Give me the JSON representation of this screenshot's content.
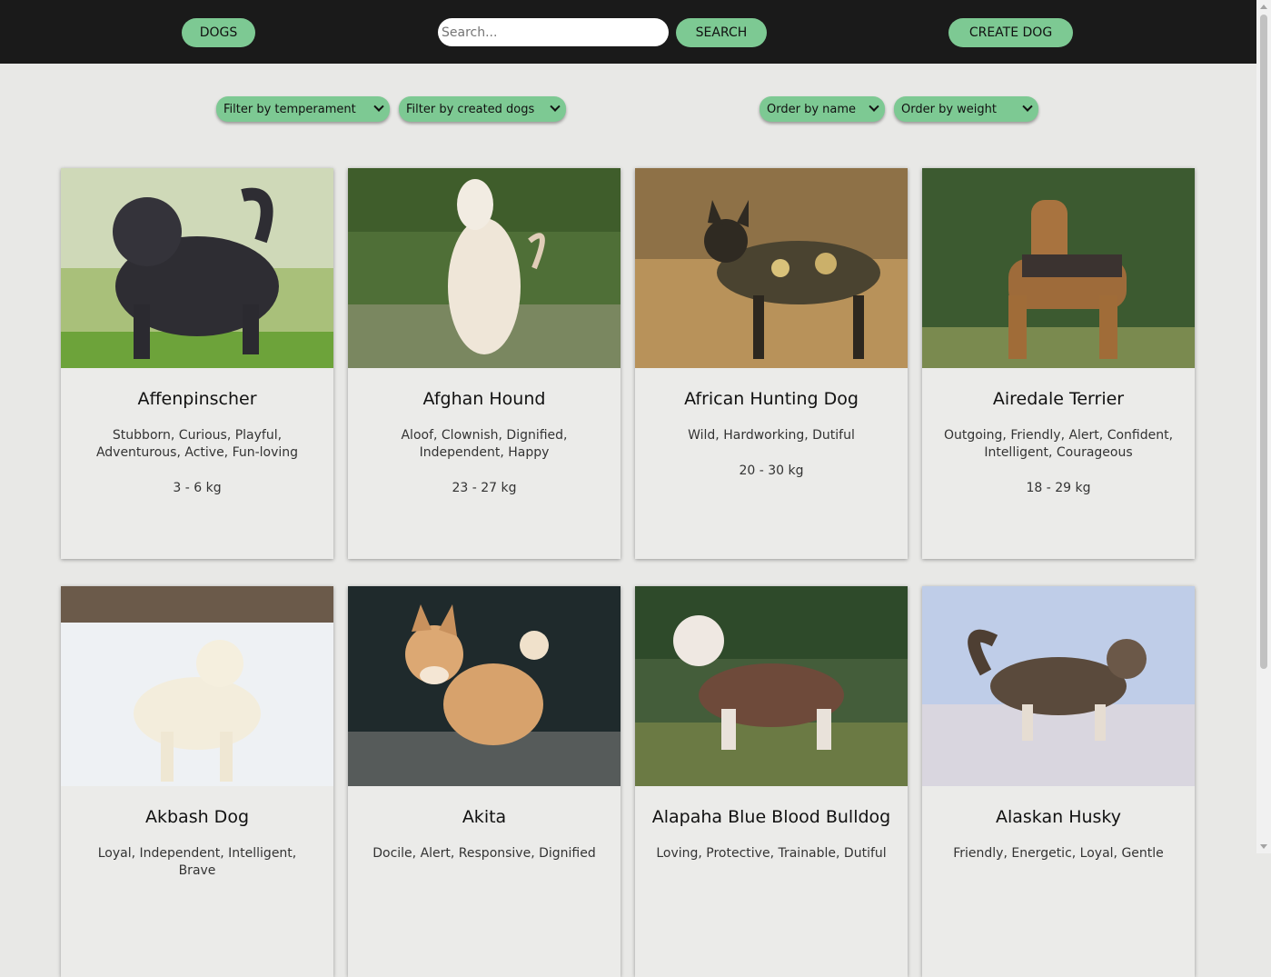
{
  "navbar": {
    "dogs_label": "DOGS",
    "search_placeholder": "Search...",
    "search_button_label": "SEARCH",
    "create_label": "CREATE DOG"
  },
  "filters": {
    "temperament": "Filter by temperament",
    "created": "Filter by created dogs",
    "order_name": "Order by name",
    "order_weight": "Order by weight"
  },
  "colors": {
    "accent": "#7dc993",
    "navbar": "#1a1a1a",
    "page_bg": "#e8e8e6",
    "card_bg": "#ebebe9"
  },
  "dogs": [
    {
      "name": "Affenpinscher",
      "temperament": "Stubborn, Curious, Playful, Adventurous, Active, Fun-loving",
      "weight": "3 - 6 kg",
      "photo": "black shaggy dog photo"
    },
    {
      "name": "Afghan Hound",
      "temperament": "Aloof, Clownish, Dignified, Independent, Happy",
      "weight": "23 - 27 kg",
      "photo": "long-haired cream dog photo"
    },
    {
      "name": "African Hunting Dog",
      "temperament": "Wild, Hardworking, Dutiful",
      "weight": "20 - 30 kg",
      "photo": "spotted wild dog photo"
    },
    {
      "name": "Airedale Terrier",
      "temperament": "Outgoing, Friendly, Alert, Confident, Intelligent, Courageous",
      "weight": "18 - 29 kg",
      "photo": "tan terrier photo"
    },
    {
      "name": "Akbash Dog",
      "temperament": "Loyal, Independent, Intelligent, Brave",
      "weight": "",
      "photo": "white dog in snow photo"
    },
    {
      "name": "Akita",
      "temperament": "Docile, Alert, Responsive, Dignified",
      "weight": "",
      "photo": "orange akita photo"
    },
    {
      "name": "Alapaha Blue Blood Bulldog",
      "temperament": "Loving, Protective, Trainable, Dutiful",
      "weight": "",
      "photo": "brown white bulldog photo"
    },
    {
      "name": "Alaskan Husky",
      "temperament": "Friendly, Energetic, Loyal, Gentle",
      "weight": "",
      "photo": "husky running in snow photo"
    }
  ]
}
